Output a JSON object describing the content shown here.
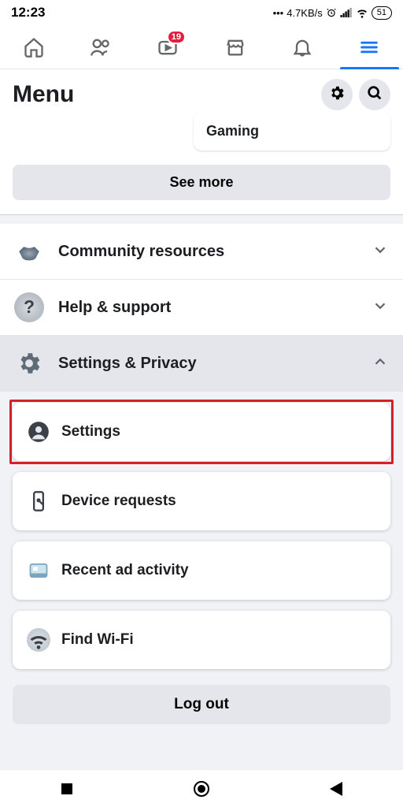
{
  "status": {
    "time": "12:23",
    "net_speed": "4.7KB/s",
    "battery": "51"
  },
  "tabs": {
    "watch_badge": "19"
  },
  "header": {
    "title": "Menu"
  },
  "shortcut_card": {
    "label": "Gaming"
  },
  "see_more": "See more",
  "rows": {
    "community": "Community resources",
    "help": "Help & support",
    "settings_privacy": "Settings & Privacy"
  },
  "settings_items": {
    "settings": "Settings",
    "device_requests": "Device requests",
    "recent_ad": "Recent ad activity",
    "find_wifi": "Find Wi-Fi"
  },
  "logout": "Log out"
}
